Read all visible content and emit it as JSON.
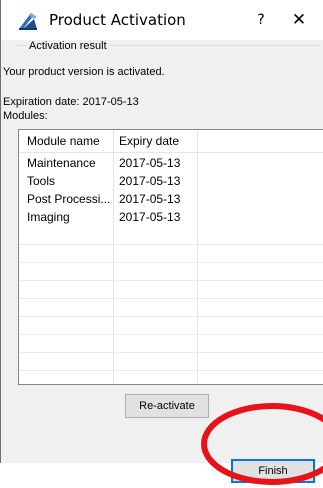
{
  "window": {
    "title": "Product Activation",
    "help_glyph": "?",
    "close_glyph": "✕"
  },
  "group": {
    "legend": "Activation result",
    "status_text": "Your product version is activated.",
    "expiration_text": "Expiration date: 2017-05-13",
    "modules_label": "Modules:"
  },
  "table": {
    "columns": [
      "Module name",
      "Expiry date"
    ],
    "rows": [
      {
        "module": "Maintenance",
        "expiry": "2017-05-13"
      },
      {
        "module": "Tools",
        "expiry": "2017-05-13"
      },
      {
        "module": "Post Processi...",
        "expiry": "2017-05-13"
      },
      {
        "module": "Imaging",
        "expiry": "2017-05-13"
      }
    ]
  },
  "buttons": {
    "reactivate_label": "Re-activate",
    "finish_label": "Finish"
  },
  "colors": {
    "annotation": "#e8121b",
    "accent": "#0078d7"
  },
  "icons": {
    "title": "product-activation-icon"
  }
}
